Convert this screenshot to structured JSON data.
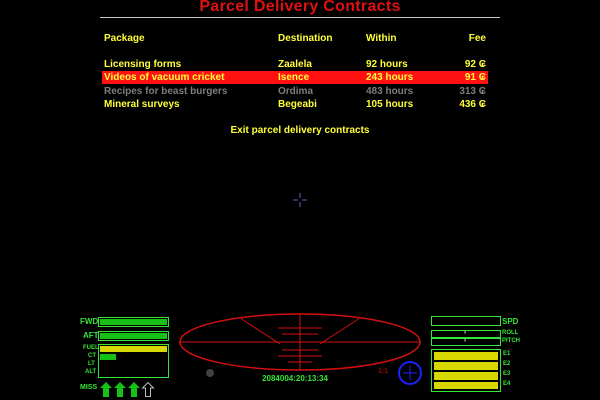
{
  "screen": {
    "title": "Parcel Delivery Contracts",
    "exit_label": "Exit parcel delivery contracts"
  },
  "table": {
    "headers": {
      "package": "Package",
      "destination": "Destination",
      "within": "Within",
      "fee": "Fee"
    },
    "rows": [
      {
        "package": "Licensing forms",
        "destination": "Zaalela",
        "within": "92 hours",
        "fee": "92 ₢",
        "state": "available"
      },
      {
        "package": "Videos of vacuum cricket",
        "destination": "Isence",
        "within": "243 hours",
        "fee": "91 ₢",
        "state": "selected"
      },
      {
        "package": "Recipes for beast burgers",
        "destination": "Ordima",
        "within": "483 hours",
        "fee": "313 ₢",
        "state": "unavailable"
      },
      {
        "package": "Mineral surveys",
        "destination": "Begeabi",
        "within": "105 hours",
        "fee": "436 ₢",
        "state": "available"
      }
    ]
  },
  "hud": {
    "left_labels": {
      "fwd": "FWD",
      "aft": "AFT",
      "fuel": "FUEL",
      "ct": "CT",
      "lt": "LT",
      "alt": "ALT",
      "miss": "MISS"
    },
    "right_labels": {
      "spd": "SPD",
      "roll": "ROLL",
      "pitch": "PITCH",
      "e1": "E1",
      "e2": "E2",
      "e3": "E3",
      "e4": "E4"
    },
    "stardate": "2084004:20:13:34",
    "compass_text": "1:1",
    "levels": {
      "fwd_shield": 1.0,
      "aft_shield": 1.0,
      "fuel": 1.0,
      "cabin_temp": 0.25,
      "energy_banks": [
        1.0,
        1.0,
        1.0,
        1.0
      ],
      "missiles_loaded": 3,
      "missile_slots": 4
    },
    "colors": {
      "title": "#e01010",
      "text": "#ffff3a",
      "highlight": "#ff1111",
      "dim": "#7d7d7d",
      "hud_green": "#37e337",
      "scanner": "#d01010",
      "compass": "#2020ff"
    }
  }
}
